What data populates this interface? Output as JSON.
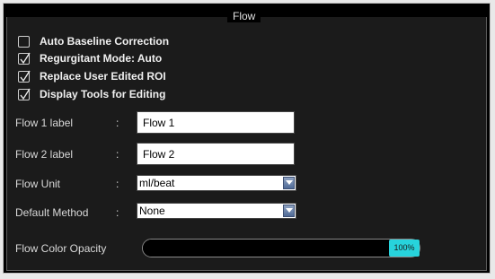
{
  "panel": {
    "title": "Flow"
  },
  "checkboxes": [
    {
      "label": "Auto Baseline Correction",
      "checked": false
    },
    {
      "label": "Regurgitant Mode: Auto",
      "checked": true
    },
    {
      "label": "Replace User Edited ROI",
      "checked": true
    },
    {
      "label": "Display Tools for Editing",
      "checked": true
    }
  ],
  "fields": {
    "colon": ":",
    "flow1": {
      "label": "Flow 1 label",
      "value": "Flow 1"
    },
    "flow2": {
      "label": "Flow 2 label",
      "value": "Flow 2"
    },
    "flow_unit": {
      "label": "Flow Unit",
      "value": "ml/beat"
    },
    "default_method": {
      "label": "Default Method",
      "value": "None"
    }
  },
  "opacity": {
    "label": "Flow Color Opacity",
    "value_text": "100%",
    "value": 100
  },
  "colors": {
    "slider_thumb": "#27d3dc",
    "dropdown_arrow": "#4f6a96"
  }
}
